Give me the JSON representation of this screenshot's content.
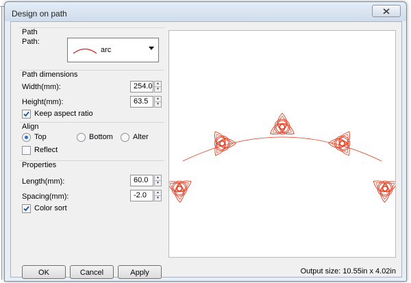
{
  "dialog": {
    "title": "Design on path",
    "close_label": "X"
  },
  "path_group": {
    "title": "Path",
    "path_label": "Path:",
    "path_value": "arc"
  },
  "dimensions_group": {
    "title": "Path dimensions",
    "width_label": "Width(mm):",
    "width_value": "254.0",
    "height_label": "Height(mm):",
    "height_value": "63.5",
    "keep_aspect_label": "Keep aspect ratio",
    "keep_aspect_checked": true
  },
  "align_group": {
    "title": "Align",
    "options": [
      "Top",
      "Bottom",
      "Alter"
    ],
    "selected": "Top",
    "reflect_label": "Reflect",
    "reflect_checked": false
  },
  "properties_group": {
    "title": "Properties",
    "length_label": "Length(mm):",
    "length_value": "60.0",
    "spacing_label": "Spacing(mm):",
    "spacing_value": "-2.0",
    "color_sort_label": "Color sort",
    "color_sort_checked": true
  },
  "buttons": {
    "ok": "OK",
    "cancel": "Cancel",
    "apply": "Apply"
  },
  "output_size": "Output size: 10.55in x 4.02in",
  "preview": {
    "motif_color": "#e03a1e",
    "motif_count": 5,
    "arc_color": "#e03a1e"
  }
}
